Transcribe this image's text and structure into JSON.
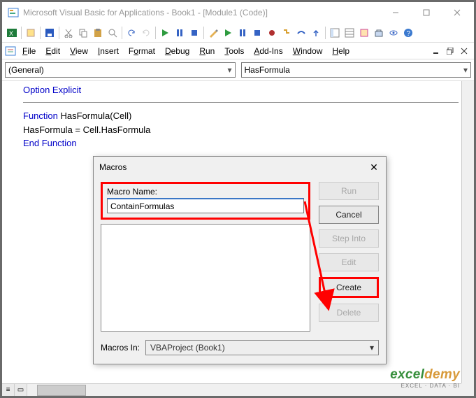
{
  "titlebar": "Microsoft Visual Basic for Applications - Book1 - [Module1 (Code)]",
  "menu": {
    "file": "File",
    "edit": "Edit",
    "view": "View",
    "insert": "Insert",
    "format": "Format",
    "debug": "Debug",
    "run": "Run",
    "tools": "Tools",
    "addins": "Add-Ins",
    "window": "Window",
    "help": "Help"
  },
  "combo": {
    "left": "(General)",
    "right": "HasFormula"
  },
  "code": {
    "l1": "Option Explicit",
    "l2": "Function ",
    "l2b": "HasFormula(Cell)",
    "l3": "HasFormula = Cell.HasFormula",
    "l4": "End Function"
  },
  "dialog": {
    "title": "Macros",
    "nameLabel": "Macro Name:",
    "nameValue": "ContainFormulas",
    "btnRun": "Run",
    "btnCancel": "Cancel",
    "btnStepInto": "Step Into",
    "btnEdit": "Edit",
    "btnCreate": "Create",
    "btnDelete": "Delete",
    "macrosInLabel": "Macros In:",
    "macrosInValue": "VBAProject (Book1)"
  },
  "watermark": {
    "brandA": "excel",
    "brandB": "demy",
    "sub": "EXCEL · DATA · BI"
  }
}
